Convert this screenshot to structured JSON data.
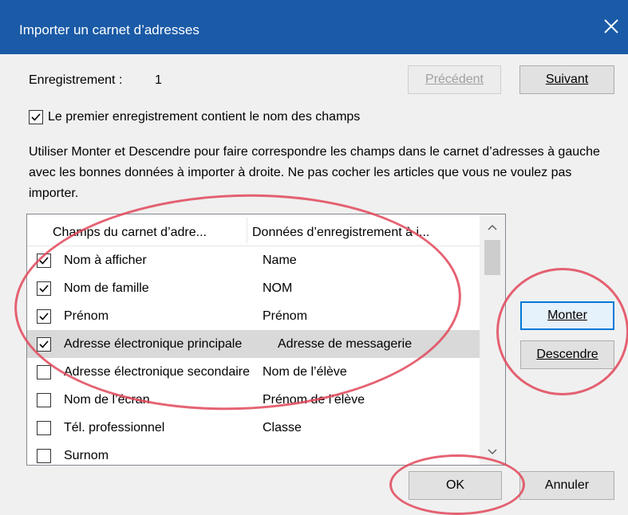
{
  "window": {
    "title": "Importer un carnet d’adresses",
    "close_glyph": "✕"
  },
  "record": {
    "label": "Enregistrement :",
    "value": "1"
  },
  "nav": {
    "prev_label": "Précédent",
    "next_label": "Suivant"
  },
  "first_record_checkbox": {
    "label": "Le premier enregistrement contient le nom des champs",
    "checked": true
  },
  "instructions": "Utiliser Monter et Descendre pour faire correspondre les champs dans le carnet d’adresses à gauche avec les bonnes données à importer à droite. Ne pas cocher les articles que vous ne voulez pas importer.",
  "list": {
    "columns": [
      "Champs du carnet d’adre...",
      "Données d’enregistrement à i..."
    ],
    "rows": [
      {
        "field": "Nom à afficher",
        "value": "Name",
        "checked": true
      },
      {
        "field": "Nom de famille",
        "value": "NOM",
        "checked": true
      },
      {
        "field": "Prénom",
        "value": "Prénom",
        "checked": true
      },
      {
        "field": "Adresse électronique principale",
        "value": "Adresse de messagerie",
        "checked": true,
        "selected": true
      },
      {
        "field": "Adresse électronique secondaire",
        "value": "Nom de l’élève",
        "checked": false
      },
      {
        "field": "Nom de l’écran",
        "value": "Prénom de l’élève",
        "checked": false
      },
      {
        "field": "Tél. professionnel",
        "value": "Classe",
        "checked": false
      },
      {
        "field": "Surnom",
        "value": "",
        "checked": false
      }
    ]
  },
  "side_buttons": {
    "up_label": "Monter",
    "down_label": "Descendre"
  },
  "footer": {
    "ok_label": "OK",
    "cancel_label": "Annuler"
  },
  "colors": {
    "titlebar": "#1a5aa7",
    "annotation": "#e0485a",
    "focus": "#0078d7"
  }
}
